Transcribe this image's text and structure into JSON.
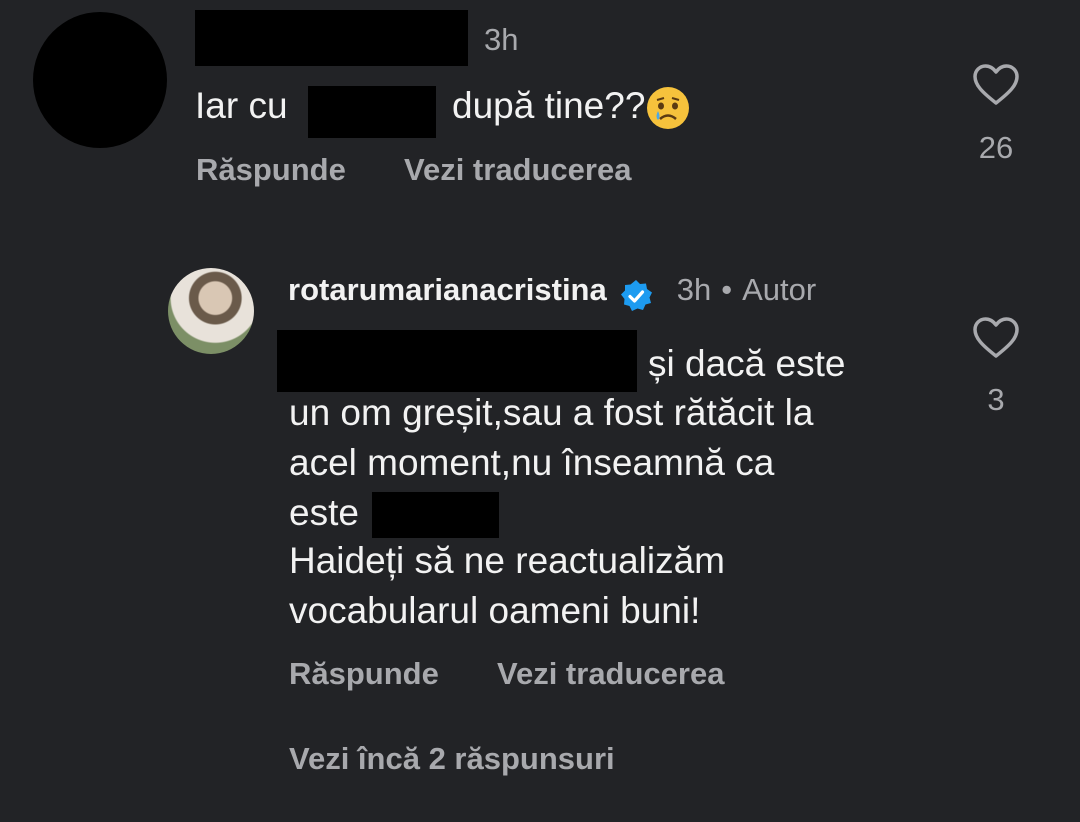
{
  "comment1": {
    "time": "3h",
    "text_before": "Iar cu",
    "text_after": "după tine??",
    "emoji": "crying-face",
    "reply_label": "Răspunde",
    "translate_label": "Vezi traducerea",
    "like_count": "26"
  },
  "reply": {
    "username": "rotarumarianacristina",
    "time": "3h",
    "separator": "•",
    "author_tag": "Autor",
    "line1_after": "și dacă este",
    "line2": "un om greșit,sau a fost rătăcit la",
    "line3": "acel moment,nu înseamnă ca",
    "line4_before": "este",
    "line5": "Haideți să ne reactualizăm",
    "line6": "vocabularul oameni buni!",
    "reply_label": "Răspunde",
    "translate_label": "Vezi traducerea",
    "like_count": "3"
  },
  "more_replies": "Vezi încă 2 răspunsuri",
  "colors": {
    "background": "#222326",
    "text": "#f2f2f2",
    "secondary": "#a8a9ad",
    "verified": "#1d9bf0"
  }
}
